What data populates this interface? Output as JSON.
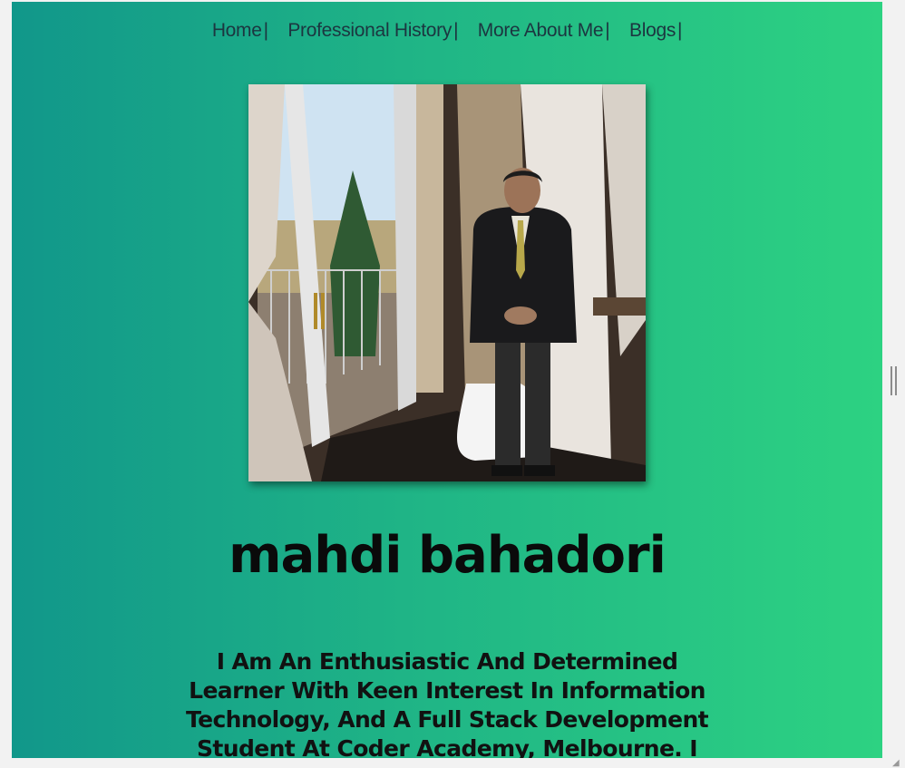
{
  "nav": {
    "items": [
      {
        "label": "Home"
      },
      {
        "label": "Professional History"
      },
      {
        "label": "More About Me"
      },
      {
        "label": "Blogs"
      }
    ],
    "separator": "|"
  },
  "profile": {
    "photo_icon": "portrait-photo",
    "name": "mahdi bahadori",
    "bio": "I Am An Enthusiastic And Determined Learner With Keen Interest In Information Technology, And A Full Stack Development Student At Coder Academy, Melbourne. I Am Passionate About"
  },
  "colors": {
    "gradient_start": "#11978a",
    "gradient_end": "#2dd282",
    "nav_text": "#1c3640"
  }
}
